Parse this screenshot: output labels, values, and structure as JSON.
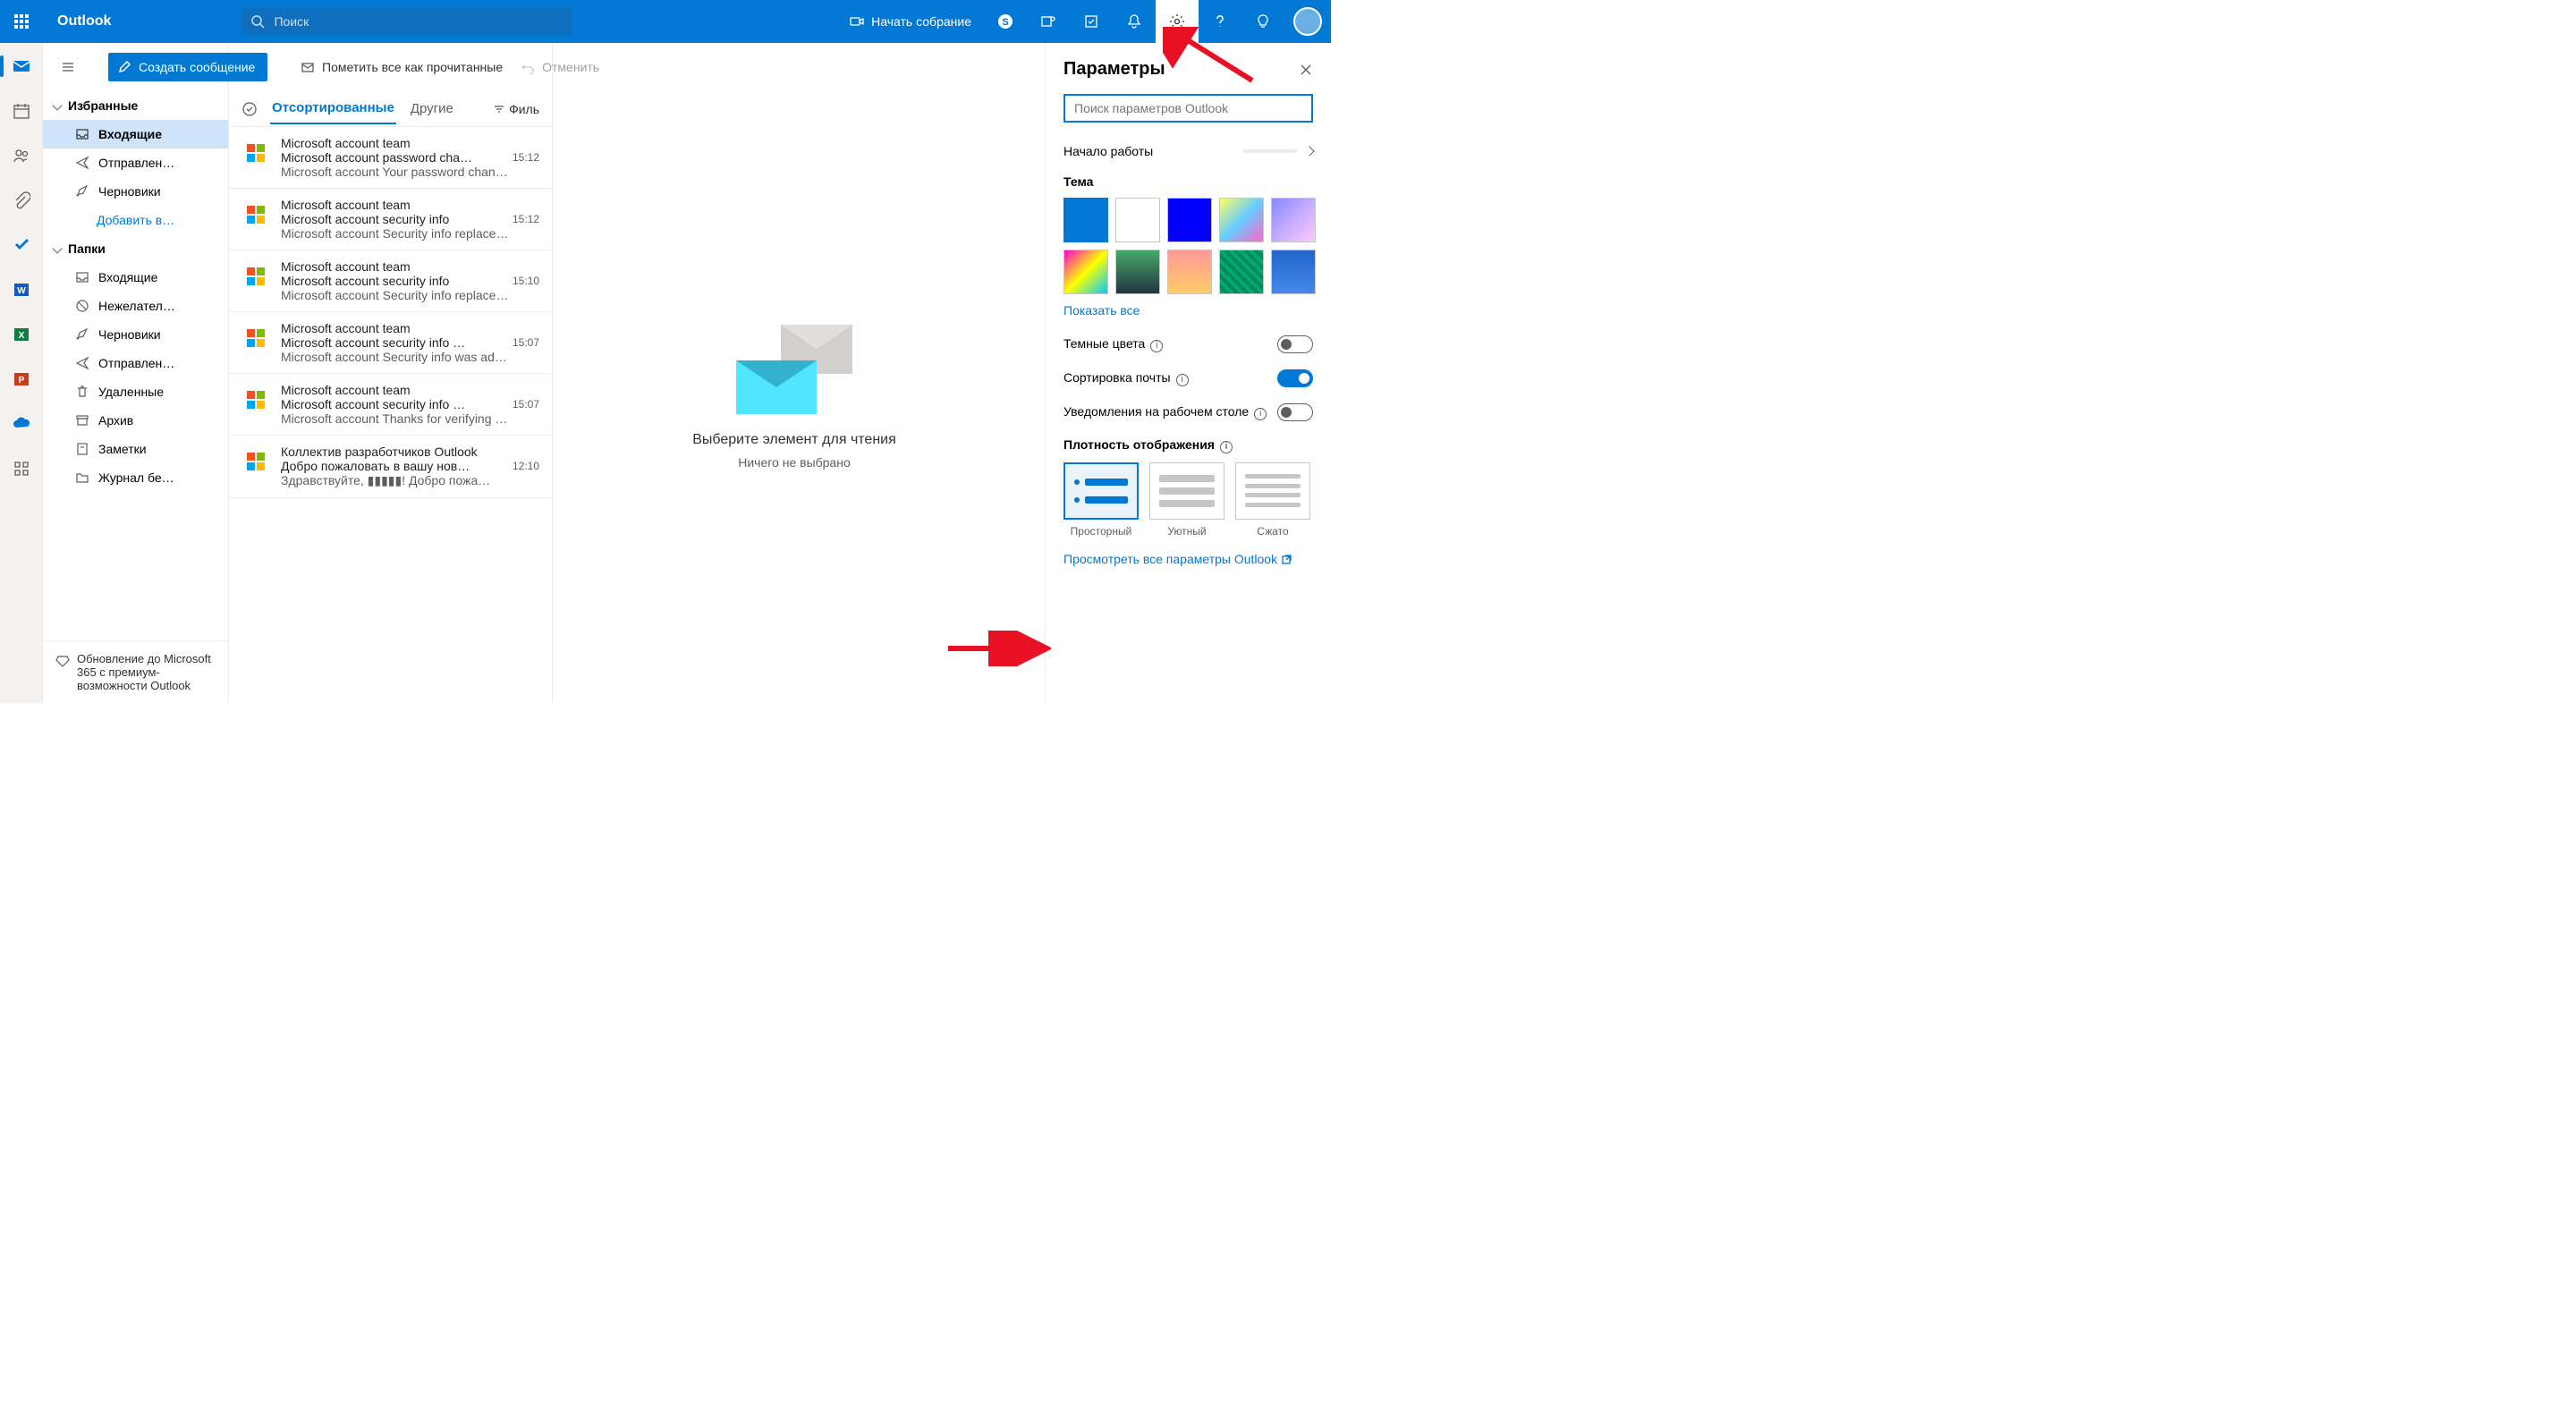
{
  "header": {
    "brand": "Outlook",
    "search_placeholder": "Поиск",
    "meeting": "Начать собрание"
  },
  "compose": "Создать сообщение",
  "cmd": {
    "mark_read": "Пометить все как прочитанные",
    "undo": "Отменить"
  },
  "nav": {
    "favorites": "Избранные",
    "fav_items": [
      "Входящие",
      "Отправлен…",
      "Черновики"
    ],
    "add_favorite": "Добавить в…",
    "folders": "Папки",
    "folder_items": [
      "Входящие",
      "Нежелател…",
      "Черновики",
      "Отправлен…",
      "Удаленные",
      "Архив",
      "Заметки",
      "Журнал бе…"
    ],
    "upgrade": "Обновление до Microsoft 365 с премиум-возможности Outlook"
  },
  "list": {
    "tab_focused": "Отсортированные",
    "tab_other": "Другие",
    "filter": "Филь"
  },
  "messages": [
    {
      "from": "Microsoft account team",
      "subject": "Microsoft account password cha…",
      "time": "15:12",
      "preview": "Microsoft account Your password chan…"
    },
    {
      "from": "Microsoft account team",
      "subject": "Microsoft account security info",
      "time": "15:12",
      "preview": "Microsoft account Security info replace…"
    },
    {
      "from": "Microsoft account team",
      "subject": "Microsoft account security info",
      "time": "15:10",
      "preview": "Microsoft account Security info replace…"
    },
    {
      "from": "Microsoft account team",
      "subject": "Microsoft account security info …",
      "time": "15:07",
      "preview": "Microsoft account Security info was ad…"
    },
    {
      "from": "Microsoft account team",
      "subject": "Microsoft account security info …",
      "time": "15:07",
      "preview": "Microsoft account Thanks for verifying …"
    },
    {
      "from": "Коллектив разработчиков Outlook",
      "subject": "Добро пожаловать в вашу нов…",
      "time": "12:10",
      "preview": "Здравствуйте, ▮▮▮▮▮! Добро пожа…"
    }
  ],
  "reading": {
    "title": "Выберите элемент для чтения",
    "sub": "Ничего не выбрано"
  },
  "settings": {
    "title": "Параметры",
    "search_placeholder": "Поиск параметров Outlook",
    "getting_started": "Начало работы",
    "theme": "Тема",
    "show_all": "Показать все",
    "dark": "Темные цвета",
    "focused": "Сортировка почты",
    "desktop_notif": "Уведомления на рабочем столе",
    "density": "Плотность отображения",
    "density_opts": [
      "Просторный",
      "Уютный",
      "Сжато"
    ],
    "view_all": "Просмотреть все параметры Outlook"
  }
}
